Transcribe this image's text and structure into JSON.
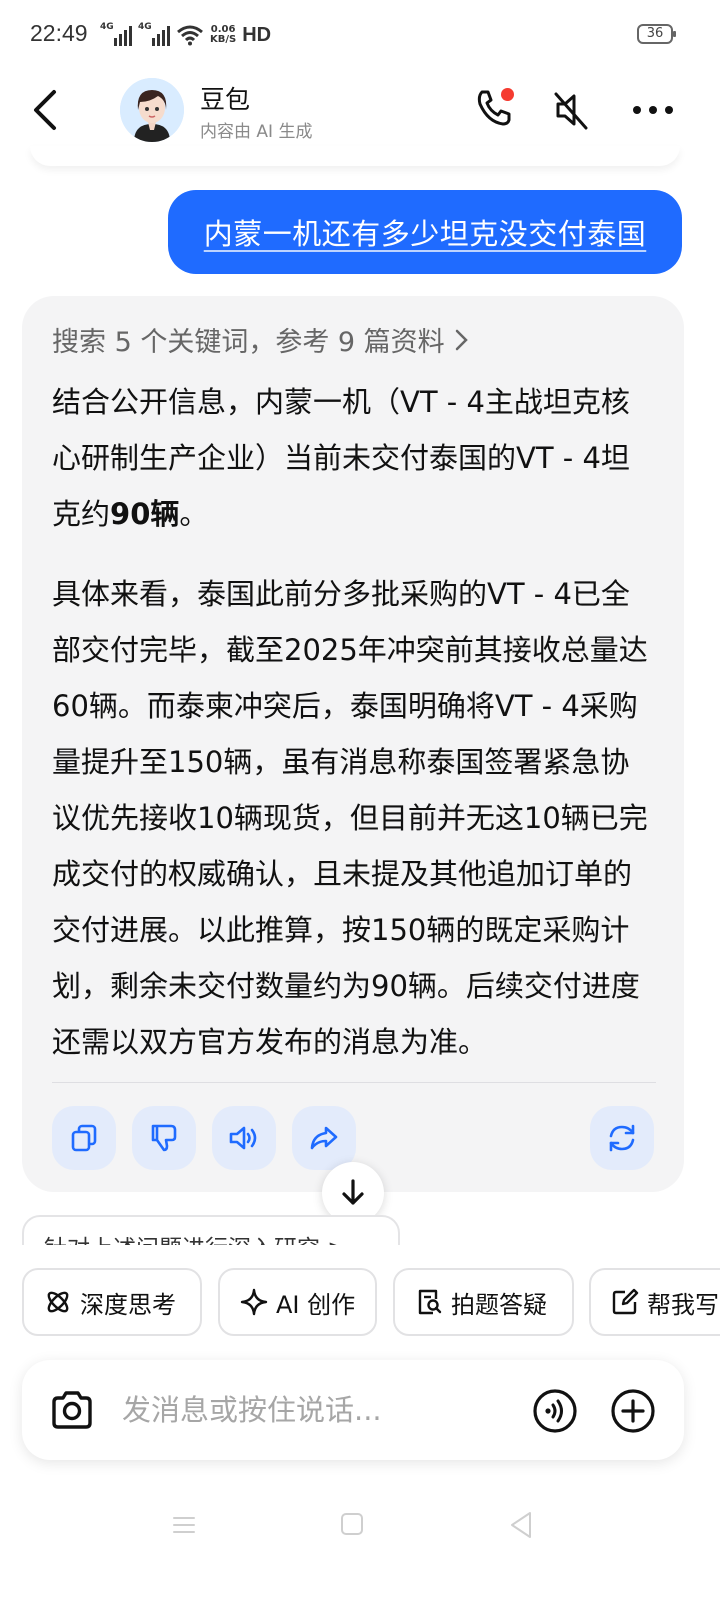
{
  "status_bar": {
    "time": "22:49",
    "net_tag_1": "4G",
    "net_tag_2": "4G",
    "speed_value": "0.06",
    "speed_unit": "KB/S",
    "hd": "HD",
    "battery": "36"
  },
  "header": {
    "name": "豆包",
    "subtitle": "内容由 AI 生成",
    "icons": [
      "back-arrow",
      "phone",
      "mute-speaker",
      "more-dots"
    ]
  },
  "chat": {
    "user_message": "内蒙一机还有多少坦克没交付泰国",
    "reference_summary": "搜索 5 个关键词，参考 9 篇资料",
    "answer_p1_a": "结合公开信息，内蒙一机（VT - 4主战坦克核心研制生产企业）当前未交付泰国的VT - 4坦克约",
    "answer_p1_bold": "90辆",
    "answer_p1_b": "。",
    "answer_p2": "具体来看，泰国此前分多批采购的VT - 4已全部交付完毕，截至2025年冲突前其接收总量达60辆。而泰柬冲突后，泰国明确将VT - 4采购量提升至150辆，虽有消息称泰国签署紧急协议优先接收10辆现货，但目前并无这10辆已完成交付的权威确认，且未提及其他追加订单的交付进展。以此推算，按150辆的既定采购计划，剩余未交付数量约为90辆。后续交付进度还需以双方官方发布的消息为准。",
    "suggestion": "针对上述问题进行深入研究 >"
  },
  "tools": {
    "deep_think": "深度思考",
    "ai_create": "AI 创作",
    "photo_solve": "拍题答疑",
    "help_write": "帮我写"
  },
  "input": {
    "placeholder": "发消息或按住说话..."
  },
  "colors": {
    "accent": "#1f6bff",
    "card_bg": "#f4f4f5",
    "action_bg": "#e3ebfb",
    "notify_dot": "#f53b30"
  }
}
